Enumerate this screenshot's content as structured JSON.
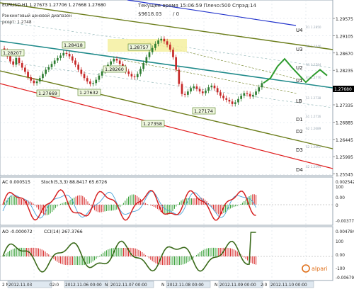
{
  "header": {
    "symbol_line": "EURUSD,H1  1.27673 1.27706 1.27668 1.27680",
    "server_time": "Текущее время 15:06:59 Плечо:500 Спрэд:14",
    "balance": "$9618.03",
    "slash_zero": "/ 0",
    "indicator_name": "Рэнкинговый ценовой диапазон",
    "indicator_sub": "рсорт: 1.2748"
  },
  "colors": {
    "background": "#ffffff",
    "grid": "#cfd8e0",
    "candle_up": "#2e7d32",
    "candle_down": "#c62828",
    "regression_center": "#1f8a8a",
    "channel_upper": "#6b7d1a",
    "channel_lower": "#6b7d1a",
    "red_line": "#e02020",
    "blue_line": "#2233cc",
    "projection": "#2e9b2e",
    "label_fill": "#f0f8e0",
    "label_border": "#4d7a1a",
    "highlight": "#f4f0a0",
    "stoch_main": "#d62020",
    "stoch_signal": "#4aa3d8",
    "cci": "#3a6a1a",
    "ac_up": "#2e9b2e",
    "ac_down": "#d62020"
  },
  "price_axis": {
    "ticks": [
      "1.29575",
      "1.29105",
      "1.28670",
      "1.28235",
      "1.27760",
      "1.27335",
      "1.26885",
      "1.26445",
      "1.25995",
      "1.25545"
    ],
    "current_price": "1.27680"
  },
  "levels": [
    {
      "name": "U4",
      "price": "1.2913"
    },
    {
      "name": "U3",
      "price": "1.2868"
    },
    {
      "name": "U2",
      "price": "1.2818"
    },
    {
      "name": "U1",
      "price": "1.2774"
    },
    {
      "name": "LB",
      "price": "1.2739"
    },
    {
      "name": "D1",
      "price": "1.2700"
    },
    {
      "name": "D2",
      "price": "1.2660"
    },
    {
      "name": "D3",
      "price": "1.2610"
    },
    {
      "name": "D4",
      "price": "1.2565"
    }
  ],
  "level_sublabels": [
    "R1 1.2850",
    "R1 1.2846",
    "R1 1.2784",
    "R1 1.2776",
    "S1 1.2738",
    "S1 1.2716",
    "S2 1.2689",
    "S2 1.2662",
    "S2 1.2594"
  ],
  "price_labels": [
    {
      "text": "1.28207"
    },
    {
      "text": "1.28418"
    },
    {
      "text": "1.28260"
    },
    {
      "text": "1.28757"
    },
    {
      "text": "1.27669"
    },
    {
      "text": "1.27632"
    },
    {
      "text": "1.27358"
    },
    {
      "text": "1.27174"
    }
  ],
  "ac_panel": {
    "label": "AC  0.000515",
    "stoch_label": "Stoch(5,3,3)  88.8417  65.6726",
    "axis": [
      "0.002542",
      "100",
      "0.00",
      "0",
      "-0.003779"
    ]
  },
  "ao_panel": {
    "label": "AO  -0.000072",
    "cci_label": "CCI(14)  267.3766",
    "axis": [
      "0.004784",
      "100",
      "0.00",
      "-100",
      "-0.006797"
    ]
  },
  "time_axis": {
    "labels": [
      "2 N",
      "2012.11.03 ",
      "02:0",
      "2012.11.06 00:00",
      "N",
      "2012.11.07 00:00",
      "N",
      "2012.11.08 00:00",
      "N",
      "2012.11.09 00:00",
      "2:0",
      "2012.11.10 00:00"
    ]
  },
  "watermark": "alpari",
  "chart_data": {
    "type": "candlestick",
    "title": "EURUSD,H1",
    "ylim": [
      1.255,
      1.296
    ],
    "ohlc_close": [
      1.2845,
      1.2832,
      1.282,
      1.2812,
      1.2828,
      1.2816,
      1.2805,
      1.2795,
      1.2782,
      1.2774,
      1.2768,
      1.2772,
      1.278,
      1.279,
      1.28,
      1.2806,
      1.2814,
      1.2822,
      1.2828,
      1.2834,
      1.284,
      1.2838,
      1.2832,
      1.2822,
      1.2812,
      1.28,
      1.279,
      1.278,
      1.2772,
      1.2766,
      1.2768,
      1.2776,
      1.2786,
      1.2796,
      1.2803,
      1.2812,
      1.282,
      1.2826,
      1.2822,
      1.2814,
      1.2806,
      1.2796,
      1.279,
      1.2784,
      1.2782,
      1.279,
      1.2802,
      1.2816,
      1.283,
      1.2842,
      1.2852,
      1.2862,
      1.287,
      1.2874,
      1.2868,
      1.286,
      1.2848,
      1.283,
      1.28,
      1.2766,
      1.2742,
      1.274,
      1.2748,
      1.2756,
      1.276,
      1.2754,
      1.2748,
      1.2744,
      1.275,
      1.2758,
      1.2762,
      1.2756,
      1.2746,
      1.2738,
      1.2732,
      1.2728,
      1.2724,
      1.2718,
      1.2722,
      1.273,
      1.2738,
      1.2744,
      1.2742,
      1.2736,
      1.274,
      1.2748,
      1.2758,
      1.2768
    ],
    "projection": [
      1.2768,
      1.278,
      1.2808,
      1.2826,
      1.2806,
      1.2788,
      1.277,
      1.2786,
      1.28,
      1.2786
    ]
  }
}
